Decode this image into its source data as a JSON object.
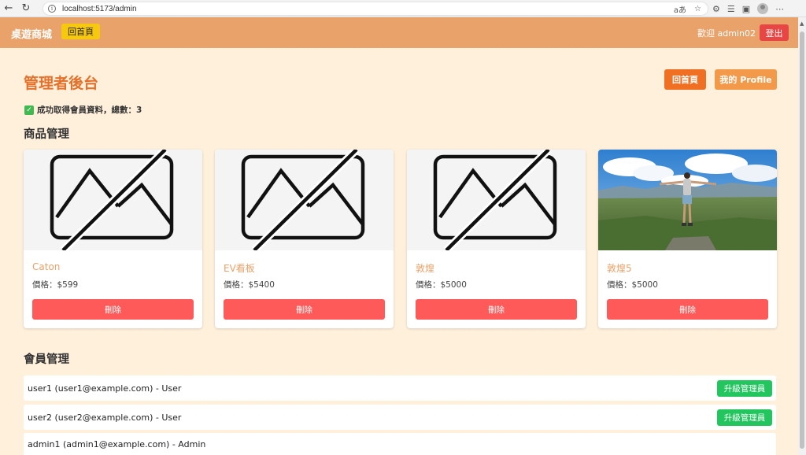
{
  "browser": {
    "url": "localhost:5173/admin",
    "read_aloud_label": "aあ"
  },
  "navbar": {
    "brand": "桌遊商城",
    "home_button": "回首頁",
    "welcome": "歡迎 admin02",
    "logout_button": "登出",
    "bg_color": "#e9a26a"
  },
  "page": {
    "title": "管理者後台",
    "home_button": "回首頁",
    "profile_button": "我的 Profile",
    "status_message": "成功取得會員資料，總數：3"
  },
  "products": {
    "section_title": "商品管理",
    "items": [
      {
        "name": "Caton",
        "price": "價格：$599",
        "delete_label": "刪除",
        "image": "broken-image-icon"
      },
      {
        "name": "EV看板",
        "price": "價格：$5400",
        "delete_label": "刪除",
        "image": "broken-image-icon"
      },
      {
        "name": "敦煌",
        "price": "價格：$5000",
        "delete_label": "刪除",
        "image": "broken-image-icon"
      },
      {
        "name": "敦煌5",
        "price": "價格：$5000",
        "delete_label": "刪除",
        "image": "landscape-photo"
      }
    ]
  },
  "members": {
    "section_title": "會員管理",
    "items": [
      {
        "text": "user1 (user1@example.com) - User",
        "action": "升級管理員"
      },
      {
        "text": "user2 (user2@example.com) - User",
        "action": "升級管理員"
      },
      {
        "text": "admin1 (admin1@example.com) - Admin",
        "action": ""
      }
    ]
  }
}
